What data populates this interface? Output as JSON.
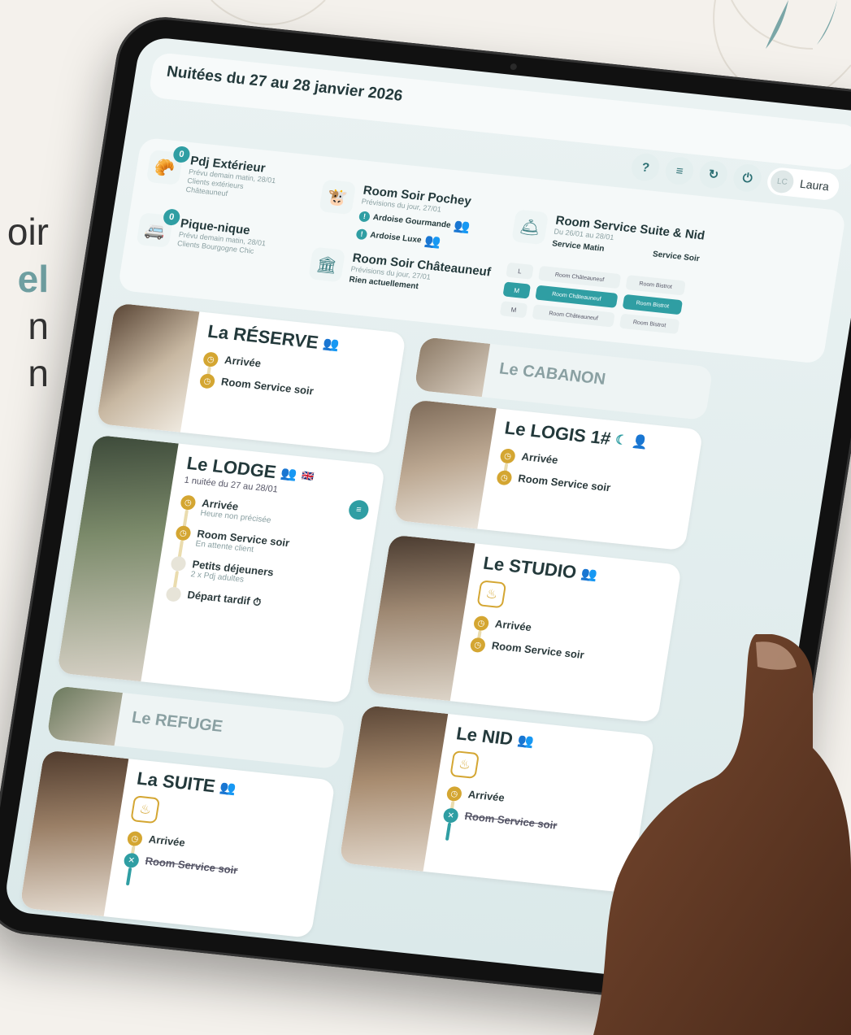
{
  "marketing": {
    "line1": "oir",
    "line2": "el",
    "line3": "n",
    "line4": "n"
  },
  "header": {
    "title": "Nuitées du 27 au 28 janvier 2026",
    "help": "?",
    "list": "≡",
    "refresh": "↻",
    "power": "⏻",
    "avatar_initials": "LC",
    "user_name": "Laura"
  },
  "services": {
    "pdj": {
      "title": "Pdj Extérieur",
      "badge": "0",
      "sub1": "Prévu demain matin, 28/01",
      "sub2": "Clients extérieurs",
      "sub3": "Châteauneuf"
    },
    "picnic": {
      "title": "Pique-nique",
      "badge": "0",
      "sub1": "Prévu demain matin, 28/01",
      "sub2": "Clients Bourgogne Chic"
    },
    "pochey": {
      "title": "Room Soir Pochey",
      "sub1": "Prévisions du jour, 27/01",
      "line1": "Ardoise Gourmande",
      "line2": "Ardoise Luxe"
    },
    "chateauneuf": {
      "title": "Room Soir Châteauneuf",
      "sub1": "Prévisions du jour, 27/01",
      "line1": "Rien actuellement"
    },
    "suite_nid": {
      "title": "Room Service Suite & Nid",
      "sub1": "Du 26/01 au 28/01",
      "col1": "Service Matin",
      "col2": "Service Soir",
      "rows": [
        {
          "label": "L",
          "morning": "Room Châteauneuf",
          "evening": "Room Bistrot",
          "active": false
        },
        {
          "label": "M",
          "morning": "Room Châteauneuf",
          "evening": "Room Bistrot",
          "active": true
        },
        {
          "label": "M",
          "morning": "Room Châteauneuf",
          "evening": "Room Bistrot",
          "active": false
        }
      ]
    }
  },
  "rooms": {
    "reserve": {
      "name": "La RÉSERVE",
      "s1": "Arrivée",
      "s2": "Room Service soir"
    },
    "cabanon": {
      "name": "Le CABANON"
    },
    "logis": {
      "name": "Le LOGIS 1#",
      "s1": "Arrivée",
      "s2": "Room Service soir"
    },
    "lodge": {
      "name": "Le LODGE",
      "sub": "1 nuitée du 27 au 28/01",
      "s1": "Arrivée",
      "s1sub": "Heure non précisée",
      "s2": "Room Service soir",
      "s2sub": "En attente client",
      "s3": "Petits déjeuners",
      "s3sub": "2 x Pdj adultes",
      "s4": "Départ tardif"
    },
    "studio": {
      "name": "Le STUDIO",
      "s1": "Arrivée",
      "s2": "Room Service soir"
    },
    "refuge": {
      "name": "Le REFUGE"
    },
    "suite": {
      "name": "La SUITE",
      "s1": "Arrivée",
      "s2": "Room Service soir"
    },
    "nid": {
      "name": "Le NID",
      "s1": "Arrivée",
      "s2": "Room Service soir"
    }
  },
  "colors": {
    "accent": "#2f9ea3",
    "gold": "#d4a632",
    "background": "#f4f1ec"
  }
}
